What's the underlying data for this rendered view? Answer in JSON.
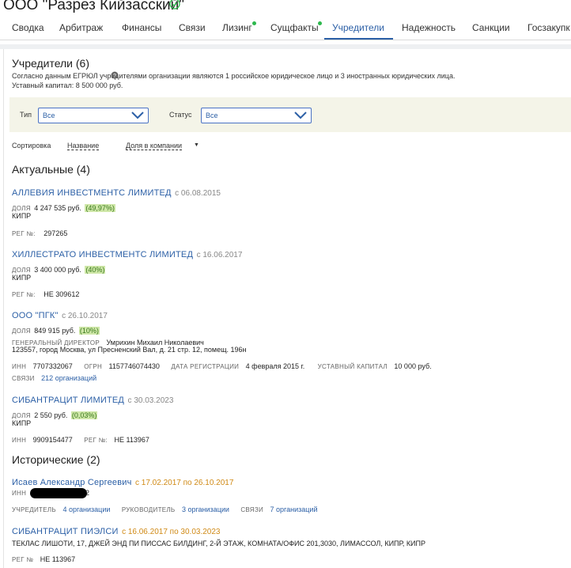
{
  "header": {
    "company_title": "ООО \"Разрез Кийзасский\"",
    "tabs": [
      "Сводка",
      "Арбитраж",
      "Финансы",
      "Связи",
      "Лизинг",
      "Сущфакты",
      "Учредители",
      "Надежность",
      "Санкции",
      "Госзакупк"
    ],
    "active_tab": "Учредители"
  },
  "founders": {
    "title": "Учредители (6)",
    "description": "Согласно данным ЕГРЮЛ учредителями организации являются 1 российское юридическое лицо и 3 иностранных юридических лица.",
    "capital": "Уставный капитал: 8 500 000 руб."
  },
  "filters": {
    "type_label": "Тип",
    "type_value": "Все",
    "status_label": "Статус",
    "status_value": "Все"
  },
  "sort": {
    "label": "Сортировка",
    "by_name": "Название",
    "by_share": "Доля в компании"
  },
  "actual": {
    "title": "Актуальные (4)",
    "items": [
      {
        "name": "АЛЛЕВИЯ ИНВЕСТМЕНТС ЛИМИТЕД",
        "since": "с 06.08.2015",
        "share_label": "ДОЛЯ",
        "share": "4 247 535 руб.",
        "pct": "(49,97%)",
        "country": "КИПР",
        "reg_label": "РЕГ №:",
        "reg": "297265"
      },
      {
        "name": "ХИЛЛЕСТРАТО ИНВЕСТМЕНТС ЛИМИТЕД",
        "since": "с 16.06.2017",
        "share_label": "ДОЛЯ",
        "share": "3 400 000 руб.",
        "pct": "(40%)",
        "country": "КИПР",
        "reg_label": "РЕГ №:",
        "reg": "НЕ 309612"
      },
      {
        "name": "ООО \"ПГК\"",
        "since": "с 26.10.2017",
        "share_label": "ДОЛЯ",
        "share": "849 915 руб.",
        "pct": "(10%)",
        "director_label": "ГЕНЕРАЛЬНЫЙ ДИРЕКТОР",
        "director": "Умрихин Михаил Николаевич",
        "address": "123557, город Москва, ул Пресненский Вал, д. 21 стр. 12, помещ. 196н",
        "inn_label": "ИНН",
        "inn": "7707332067",
        "ogrn_label": "ОГРН",
        "ogrn": "1157746074430",
        "regdate_label": "ДАТА РЕГИСТРАЦИИ",
        "regdate": "4 февраля 2015 г.",
        "capital_label": "УСТАВНЫЙ КАПИТАЛ",
        "capital": "10 000 руб.",
        "links_label": "СВЯЗИ",
        "links": "212 организаций"
      },
      {
        "name": "СИБАНТРАЦИТ ЛИМИТЕД",
        "since": "с 30.03.2023",
        "share_label": "ДОЛЯ",
        "share": "2 550 руб.",
        "pct": "(0,03%)",
        "country": "КИПР",
        "inn_label": "ИНН",
        "inn": "9909154477",
        "reg_label": "РЕГ №:",
        "reg": "НЕ 113967"
      }
    ]
  },
  "historical": {
    "title": "Исторические (2)",
    "items": [
      {
        "name": "Исаев Александр Сергеевич",
        "period": "с 17.02.2017 по 26.10.2017",
        "inn_label": "ИНН",
        "inn_tail": "2",
        "founder_label": "УЧРЕДИТЕЛЬ",
        "founder": "4 организации",
        "head_label": "РУКОВОДИТЕЛЬ",
        "head": "3 организации",
        "links_label": "СВЯЗИ",
        "links": "7 организаций"
      },
      {
        "name": "СИБАНТРАЦИТ ПИЭЛСИ",
        "period": "с 16.06.2017 по 30.03.2023",
        "address": "ТЕКЛАС ЛИШОТИ, 17, ДЖЕЙ ЭНД ПИ ПИССАС БИЛДИНГ, 2-Й ЭТАЖ, КОМНАТА/ОФИС 201,3030, ЛИМАССОЛ, КИПР, КИПР",
        "reg_label": "РЕГ №",
        "reg": "НЕ 113967"
      }
    ]
  },
  "colors": {
    "accent": "#2b5fa6",
    "green": "#2db84d",
    "highlight": "#cfe7a8",
    "orange": "#d08a16"
  }
}
